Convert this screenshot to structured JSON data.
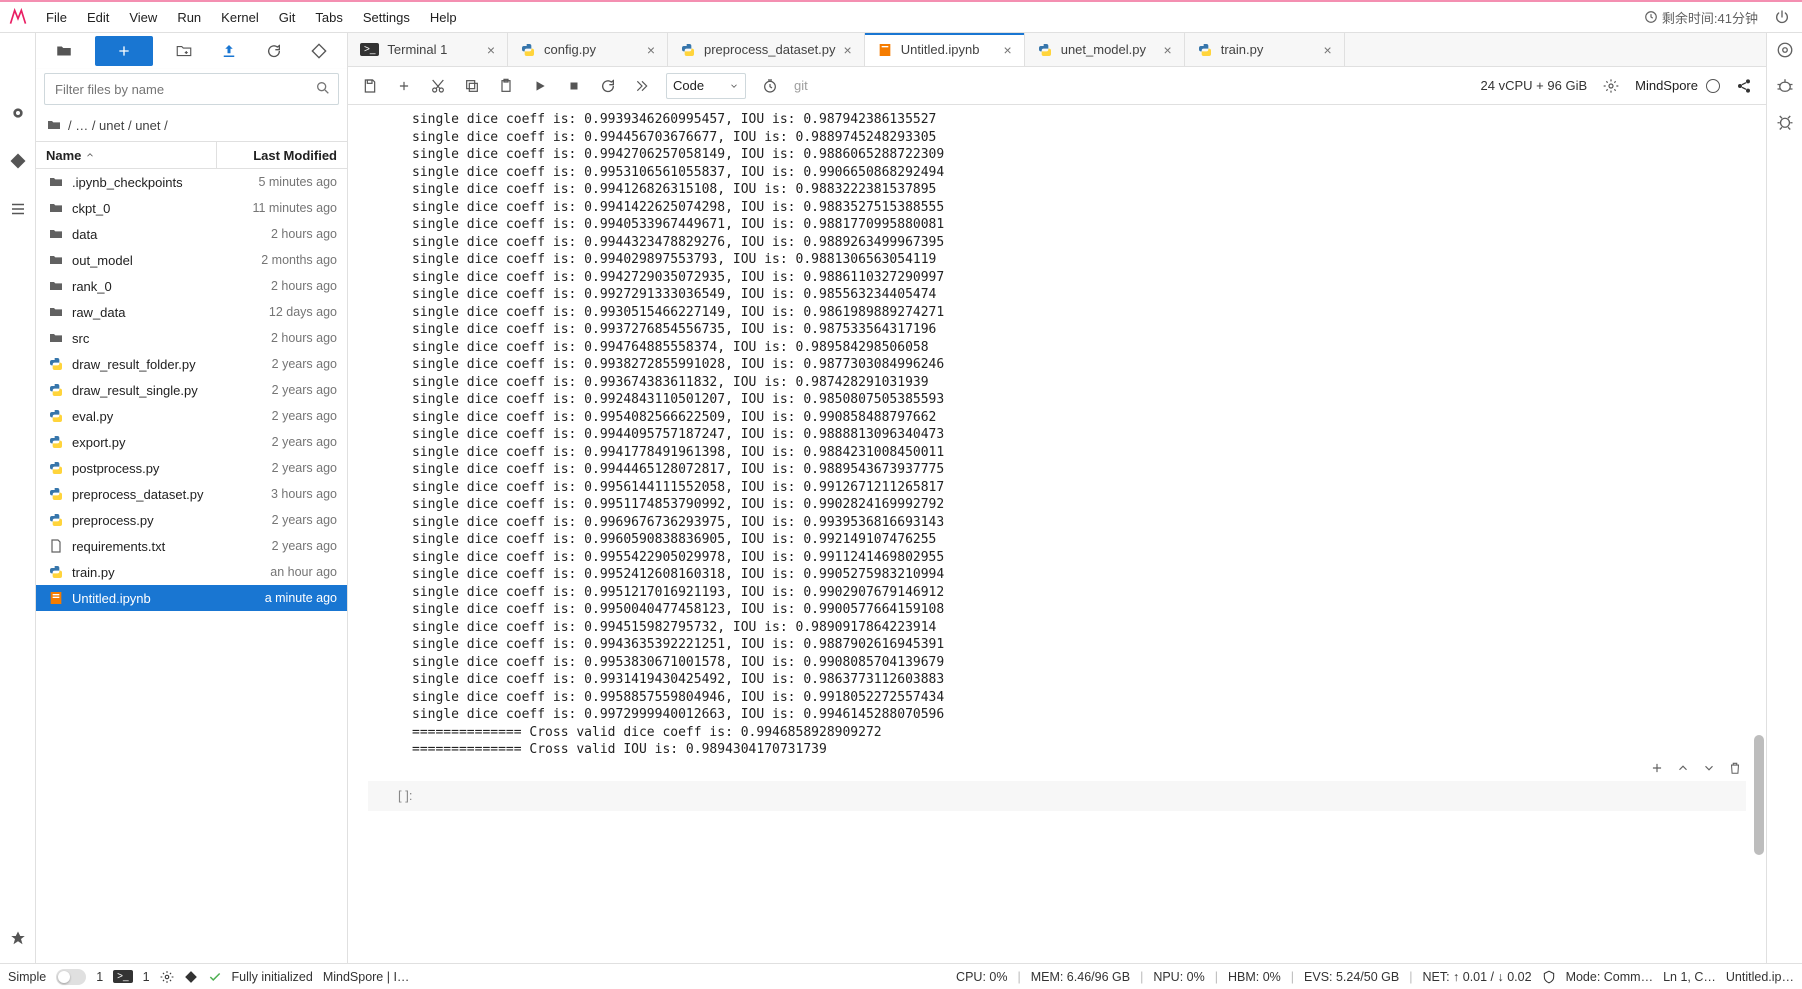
{
  "menubar": {
    "items": [
      "File",
      "Edit",
      "View",
      "Run",
      "Kernel",
      "Git",
      "Tabs",
      "Settings",
      "Help"
    ],
    "countdown": "剩余时间:41分钟"
  },
  "filebrowser": {
    "filter_placeholder": "Filter files by name",
    "breadcrumb": [
      "/",
      "…",
      "/",
      "unet",
      "/",
      "unet",
      "/"
    ],
    "header_name": "Name",
    "header_mod": "Last Modified",
    "items": [
      {
        "type": "folder",
        "name": ".ipynb_checkpoints",
        "mod": "5 minutes ago"
      },
      {
        "type": "folder",
        "name": "ckpt_0",
        "mod": "11 minutes ago"
      },
      {
        "type": "folder",
        "name": "data",
        "mod": "2 hours ago"
      },
      {
        "type": "folder",
        "name": "out_model",
        "mod": "2 months ago"
      },
      {
        "type": "folder",
        "name": "rank_0",
        "mod": "2 hours ago"
      },
      {
        "type": "folder",
        "name": "raw_data",
        "mod": "12 days ago"
      },
      {
        "type": "folder",
        "name": "src",
        "mod": "2 hours ago"
      },
      {
        "type": "py",
        "name": "draw_result_folder.py",
        "mod": "2 years ago"
      },
      {
        "type": "py",
        "name": "draw_result_single.py",
        "mod": "2 years ago"
      },
      {
        "type": "py",
        "name": "eval.py",
        "mod": "2 years ago"
      },
      {
        "type": "py",
        "name": "export.py",
        "mod": "2 years ago"
      },
      {
        "type": "py",
        "name": "postprocess.py",
        "mod": "2 years ago"
      },
      {
        "type": "py",
        "name": "preprocess_dataset.py",
        "mod": "3 hours ago"
      },
      {
        "type": "py",
        "name": "preprocess.py",
        "mod": "2 years ago"
      },
      {
        "type": "txt",
        "name": "requirements.txt",
        "mod": "2 years ago"
      },
      {
        "type": "py",
        "name": "train.py",
        "mod": "an hour ago"
      },
      {
        "type": "nb",
        "name": "Untitled.ipynb",
        "mod": "a minute ago",
        "selected": true
      }
    ]
  },
  "tabs": [
    {
      "type": "term",
      "label": "Terminal 1"
    },
    {
      "type": "py",
      "label": "config.py"
    },
    {
      "type": "py",
      "label": "preprocess_dataset.py"
    },
    {
      "type": "nb",
      "label": "Untitled.ipynb",
      "active": true
    },
    {
      "type": "py",
      "label": "unet_model.py"
    },
    {
      "type": "py",
      "label": "train.py"
    }
  ],
  "nb_toolbar": {
    "celltype": "Code",
    "git_label": "git",
    "resources": "24 vCPU + 96 GiB",
    "kernel_name": "MindSpore"
  },
  "output_lines": [
    "single dice coeff is: 0.9939346260995457, IOU is: 0.987942386135527",
    "single dice coeff is: 0.994456703676677, IOU is: 0.9889745248293305",
    "single dice coeff is: 0.9942706257058149, IOU is: 0.9886065288722309",
    "single dice coeff is: 0.9953106561055837, IOU is: 0.9906650868292494",
    "single dice coeff is: 0.994126826315108, IOU is: 0.9883222381537895",
    "single dice coeff is: 0.9941422625074298, IOU is: 0.9883527515388555",
    "single dice coeff is: 0.9940533967449671, IOU is: 0.9881770995880081",
    "single dice coeff is: 0.9944323478829276, IOU is: 0.9889263499967395",
    "single dice coeff is: 0.994029897553793, IOU is: 0.9881306563054119",
    "single dice coeff is: 0.9942729035072935, IOU is: 0.9886110327290997",
    "single dice coeff is: 0.9927291333036549, IOU is: 0.985563234405474",
    "single dice coeff is: 0.9930515466227149, IOU is: 0.9861989889274271",
    "single dice coeff is: 0.9937276854556735, IOU is: 0.987533564317196",
    "single dice coeff is: 0.994764885558374, IOU is: 0.989584298506058",
    "single dice coeff is: 0.9938272855991028, IOU is: 0.9877303084996246",
    "single dice coeff is: 0.993674383611832, IOU is: 0.987428291031939",
    "single dice coeff is: 0.9924843110501207, IOU is: 0.9850807505385593",
    "single dice coeff is: 0.9954082566622509, IOU is: 0.990858488797662",
    "single dice coeff is: 0.9944095757187247, IOU is: 0.9888813096340473",
    "single dice coeff is: 0.9941778491961398, IOU is: 0.9884231008450011",
    "single dice coeff is: 0.9944465128072817, IOU is: 0.9889543673937775",
    "single dice coeff is: 0.9956144111552058, IOU is: 0.9912671211265817",
    "single dice coeff is: 0.9951174853790992, IOU is: 0.9902824169992792",
    "single dice coeff is: 0.9969676736293975, IOU is: 0.9939536816693143",
    "single dice coeff is: 0.9960590838836905, IOU is: 0.992149107476255",
    "single dice coeff is: 0.9955422905029978, IOU is: 0.9911241469802955",
    "single dice coeff is: 0.9952412608160318, IOU is: 0.9905275983210994",
    "single dice coeff is: 0.9951217016921193, IOU is: 0.9902907679146912",
    "single dice coeff is: 0.9950040477458123, IOU is: 0.9900577664159108",
    "single dice coeff is: 0.994515982795732, IOU is: 0.9890917864223914",
    "single dice coeff is: 0.9943635392221251, IOU is: 0.9887902616945391",
    "single dice coeff is: 0.9953830671001578, IOU is: 0.9908085704139679",
    "single dice coeff is: 0.9931419430425492, IOU is: 0.9863773112603883",
    "single dice coeff is: 0.9958857559804946, IOU is: 0.9918052272557434",
    "single dice coeff is: 0.9972999940012663, IOU is: 0.9946145288070596",
    "============== Cross valid dice coeff is: 0.9946858928909272",
    "============== Cross valid IOU is: 0.9894304170731739"
  ],
  "empty_cell_prompt": "[ ]:",
  "statusbar": {
    "simple": "Simple",
    "one_a": "1",
    "one_b": "1",
    "init": "Fully initialized",
    "kernel": "MindSpore | I…",
    "cpu": "CPU: 0%",
    "mem": "MEM: 6.46/96 GB",
    "npu": "NPU: 0%",
    "hbm": "HBM: 0%",
    "evs": "EVS: 5.24/50 GB",
    "net": "NET: ↑ 0.01 / ↓ 0.02",
    "mode": "Mode: Comm…",
    "ln": "Ln 1, C…",
    "file": "Untitled.ip…"
  }
}
